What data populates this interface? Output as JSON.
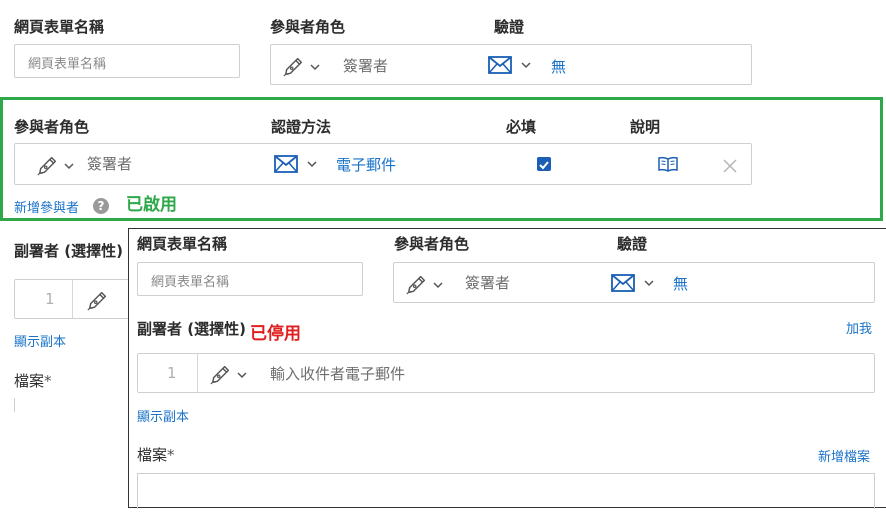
{
  "top": {
    "form_name_label": "網頁表單名稱",
    "form_name_placeholder": "網頁表單名稱",
    "role_label": "參與者角色",
    "role_value": "簽署者",
    "verify_label": "驗證",
    "verify_value": "無"
  },
  "enabled_panel": {
    "role_label": "參與者角色",
    "auth_label": "認證方法",
    "required_label": "必填",
    "desc_label": "說明",
    "role_value": "簽署者",
    "auth_value": "電子郵件",
    "required_checked": true,
    "add_participant": "新增參與者",
    "help_glyph": "?",
    "status": "已啟用",
    "status_color": "#2ea84a"
  },
  "behind": {
    "cc_label": "副署者 (選擇性)",
    "cc_num": "1",
    "show_cc": "顯示副本",
    "file_label": "檔案",
    "required_mark": "*"
  },
  "disabled_panel": {
    "form_name_label": "網頁表單名稱",
    "form_name_placeholder": "網頁表單名稱",
    "role_label": "參與者角色",
    "role_value": "簽署者",
    "verify_label": "驗證",
    "verify_value": "無",
    "cc_label": "副署者 (選擇性)",
    "status": "已停用",
    "status_color": "#e02020",
    "add_me": "加我",
    "cc_num": "1",
    "email_placeholder": "輸入收件者電子郵件",
    "show_cc": "顯示副本",
    "file_label": "檔案",
    "required_mark": "*",
    "add_file": "新增檔案"
  },
  "icons": {
    "pen": "pen-nib-icon",
    "chevron": "chevron-down-icon",
    "mail": "envelope-icon",
    "book": "book-open-icon",
    "close": "close-icon",
    "help": "help-circle-icon",
    "check": "checkmark-icon"
  },
  "colors": {
    "link": "#1a73c8",
    "accent_blue": "#1a5fb4",
    "green": "#2ea84a",
    "red": "#e02020"
  }
}
